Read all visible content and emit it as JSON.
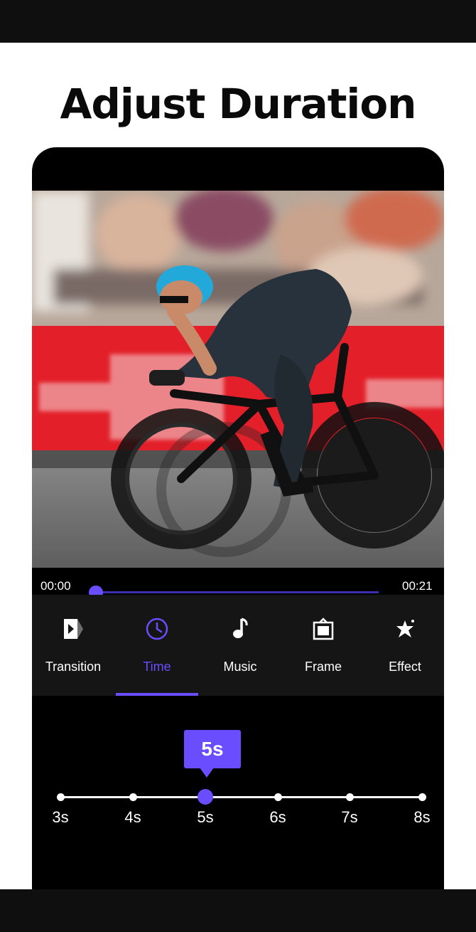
{
  "headline": "Adjust Duration",
  "player": {
    "current_time": "00:00",
    "total_time": "00:21",
    "progress": 0
  },
  "tools": [
    {
      "label": "Transition",
      "icon": "transition-icon",
      "active": false
    },
    {
      "label": "Time",
      "icon": "clock-icon",
      "active": true
    },
    {
      "label": "Music",
      "icon": "music-note-icon",
      "active": false
    },
    {
      "label": "Frame",
      "icon": "frame-icon",
      "active": false
    },
    {
      "label": "Effect",
      "icon": "sparkle-star-icon",
      "active": false
    }
  ],
  "duration": {
    "selected_label": "5s",
    "selected_value": 5,
    "options": [
      "3s",
      "4s",
      "5s",
      "6s",
      "7s",
      "8s"
    ]
  },
  "colors": {
    "accent": "#6a4dff",
    "toolbar_bg": "#151515",
    "banner_red": "#e3202a"
  }
}
